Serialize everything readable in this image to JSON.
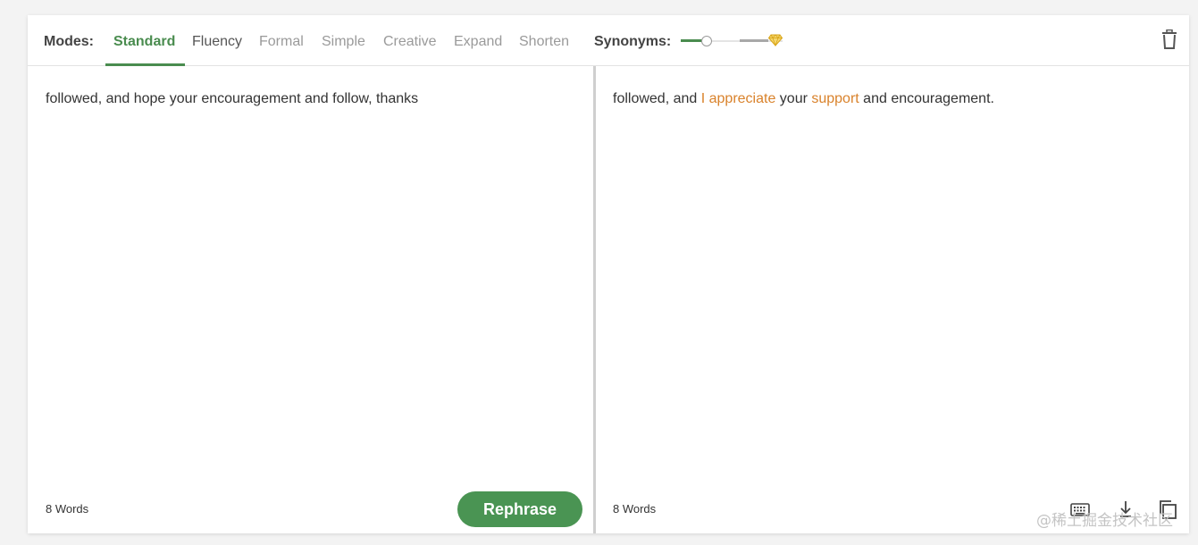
{
  "toolbar": {
    "modes_label": "Modes:",
    "modes": [
      "Standard",
      "Fluency",
      "Formal",
      "Simple",
      "Creative",
      "Expand",
      "Shorten"
    ],
    "active_mode": "Standard",
    "synonyms_label": "Synonyms:",
    "synonyms_level": 0.3
  },
  "input_pane": {
    "text": "followed, and hope your encouragement and follow, thanks",
    "word_count": "8 Words",
    "rephrase_label": "Rephrase"
  },
  "output_pane": {
    "segments": [
      {
        "text": "followed, and ",
        "changed": false
      },
      {
        "text": "I appreciate",
        "changed": true
      },
      {
        "text": " your ",
        "changed": false
      },
      {
        "text": "support",
        "changed": true
      },
      {
        "text": " and encouragement.",
        "changed": false
      }
    ],
    "word_count": "8 Words"
  },
  "watermark": "@稀土掘金技术社区",
  "colors": {
    "accent": "#4a8c4f",
    "changed_word": "#d9822b",
    "premium_gem": "#e8b923"
  }
}
